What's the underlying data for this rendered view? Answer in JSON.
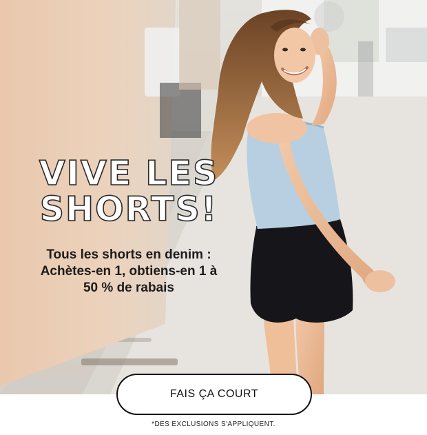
{
  "banner": {
    "headline_line1": "VIVE LES",
    "headline_line2": "SHORTS!",
    "offer_line1": "Tous les shorts en denim :",
    "offer_line2": "Achètes-en 1, obtiens-en 1 à",
    "offer_line3": "50 % de rabais",
    "cta_label": "FAIS ÇA COURT",
    "disclaimer": "*DES EXCLUSIONS S'APPLIQUENT."
  },
  "colors": {
    "text": "#1c1c1c",
    "button_border": "#111111",
    "background": "#ffffff",
    "top": "#b7cfe0",
    "shorts": "#16161a",
    "hair": "#9a6a3e"
  }
}
